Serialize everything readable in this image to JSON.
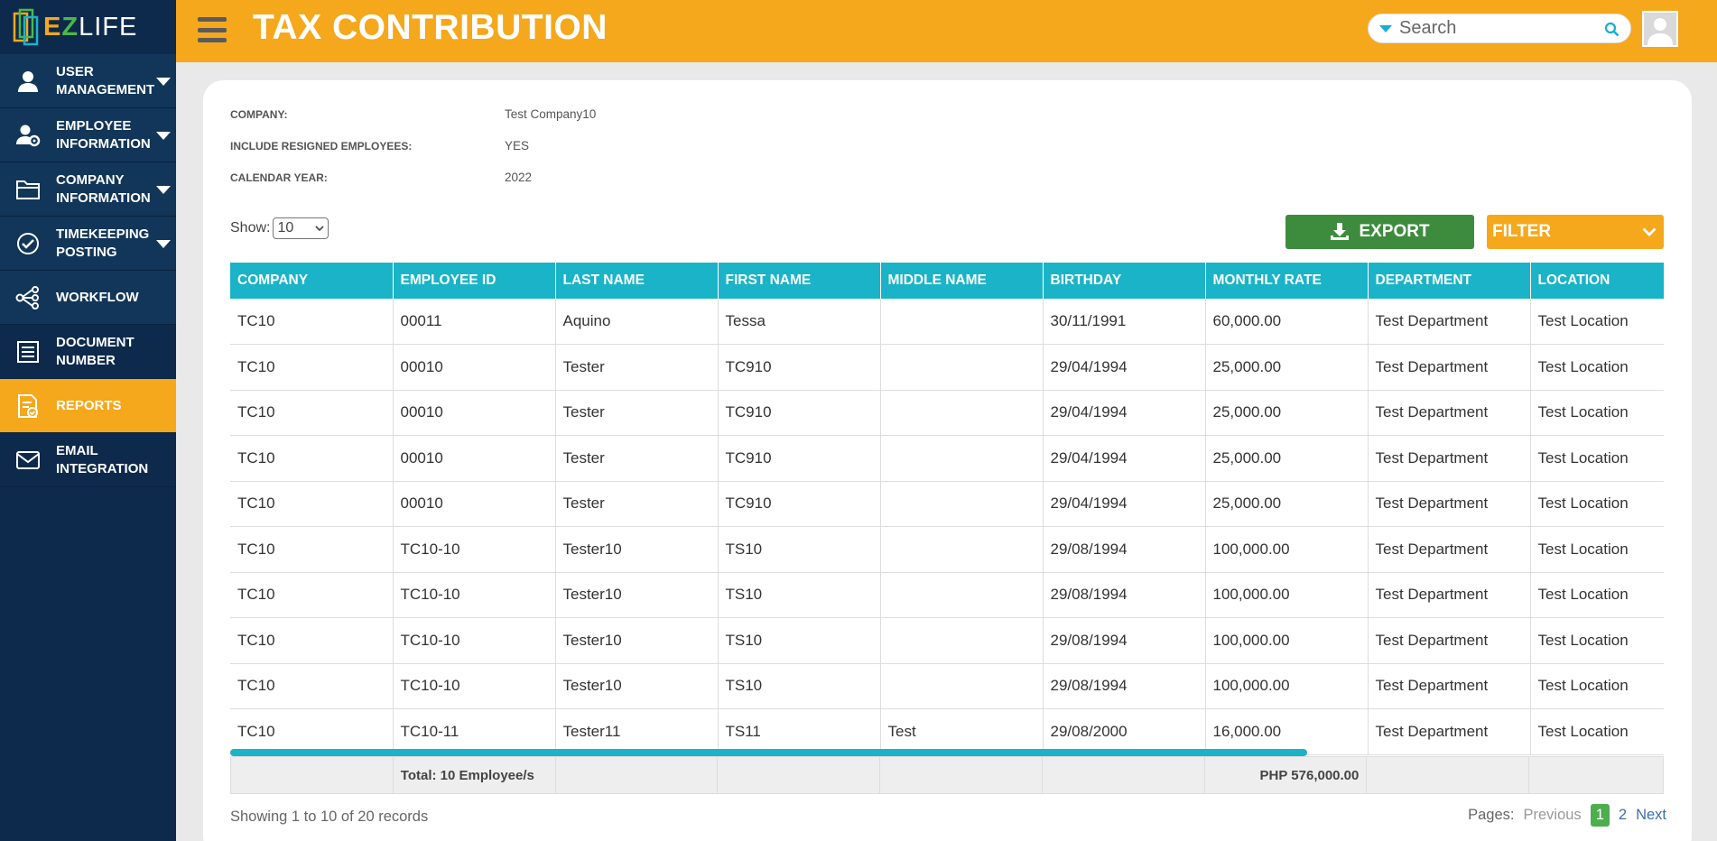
{
  "brand": {
    "logo_e": "E",
    "logo_z": "Z",
    "logo_life": "LIFE"
  },
  "sidebar": {
    "items": [
      {
        "label_1": "USER",
        "label_2": "MANAGEMENT",
        "icon": "user-icon",
        "expandable": true
      },
      {
        "label_1": "EMPLOYEE",
        "label_2": "INFORMATION",
        "icon": "user-gear-icon",
        "expandable": true
      },
      {
        "label_1": "COMPANY",
        "label_2": "INFORMATION",
        "icon": "folder-icon",
        "expandable": true
      },
      {
        "label_1": "TIMEKEEPING",
        "label_2": "POSTING",
        "icon": "check-circle-icon",
        "expandable": true
      },
      {
        "label_1": "WORKFLOW",
        "label_2": "",
        "icon": "workflow-icon",
        "expandable": false
      },
      {
        "label_1": "DOCUMENT",
        "label_2": "NUMBER",
        "icon": "document-list-icon",
        "expandable": false
      },
      {
        "label_1": "REPORTS",
        "label_2": "",
        "icon": "report-icon",
        "expandable": false,
        "active": true
      },
      {
        "label_1": "EMAIL",
        "label_2": "INTEGRATION",
        "icon": "mail-icon",
        "expandable": false
      }
    ]
  },
  "header": {
    "title": "TAX CONTRIBUTION",
    "search_placeholder": "Search",
    "accent_color": "#f5a81c"
  },
  "report_info": {
    "company_label": "COMPANY:",
    "company_value": "Test Company10",
    "resigned_label": "INCLUDE RESIGNED EMPLOYEES:",
    "resigned_value": "YES",
    "year_label": "CALENDAR YEAR:",
    "year_value": "2022"
  },
  "controls": {
    "show_label": "Show:",
    "show_value": "10",
    "export_label": "EXPORT",
    "filter_label": "FILTER"
  },
  "table": {
    "columns": [
      "COMPANY",
      "EMPLOYEE ID",
      "LAST NAME",
      "FIRST NAME",
      "MIDDLE NAME",
      "BIRTHDAY",
      "MONTHLY RATE",
      "DEPARTMENT",
      "LOCATION"
    ],
    "rows": [
      [
        "TC10",
        "00011",
        "Aquino",
        "Tessa",
        "",
        "30/11/1991",
        "60,000.00",
        "Test Department",
        "Test Location"
      ],
      [
        "TC10",
        "00010",
        "Tester",
        "TC910",
        "",
        "29/04/1994",
        "25,000.00",
        "Test Department",
        "Test Location"
      ],
      [
        "TC10",
        "00010",
        "Tester",
        "TC910",
        "",
        "29/04/1994",
        "25,000.00",
        "Test Department",
        "Test Location"
      ],
      [
        "TC10",
        "00010",
        "Tester",
        "TC910",
        "",
        "29/04/1994",
        "25,000.00",
        "Test Department",
        "Test Location"
      ],
      [
        "TC10",
        "00010",
        "Tester",
        "TC910",
        "",
        "29/04/1994",
        "25,000.00",
        "Test Department",
        "Test Location"
      ],
      [
        "TC10",
        "TC10-10",
        "Tester10",
        "TS10",
        "",
        "29/08/1994",
        "100,000.00",
        "Test Department",
        "Test Location"
      ],
      [
        "TC10",
        "TC10-10",
        "Tester10",
        "TS10",
        "",
        "29/08/1994",
        "100,000.00",
        "Test Department",
        "Test Location"
      ],
      [
        "TC10",
        "TC10-10",
        "Tester10",
        "TS10",
        "",
        "29/08/1994",
        "100,000.00",
        "Test Department",
        "Test Location"
      ],
      [
        "TC10",
        "TC10-10",
        "Tester10",
        "TS10",
        "",
        "29/08/1994",
        "100,000.00",
        "Test Department",
        "Test Location"
      ],
      [
        "TC10",
        "TC10-11",
        "Tester11",
        "TS11",
        "Test",
        "29/08/2000",
        "16,000.00",
        "Test Department",
        "Test Location"
      ]
    ],
    "header_color": "#1ab3c8"
  },
  "totals": {
    "employees": "Total: 10 Employee/s",
    "amount": "PHP 576,000.00"
  },
  "footer": {
    "showing": "Showing 1 to 10 of 20 records",
    "pages_label": "Pages:",
    "prev": "Previous",
    "pages": [
      "1",
      "2"
    ],
    "current": "1",
    "next": "Next"
  }
}
